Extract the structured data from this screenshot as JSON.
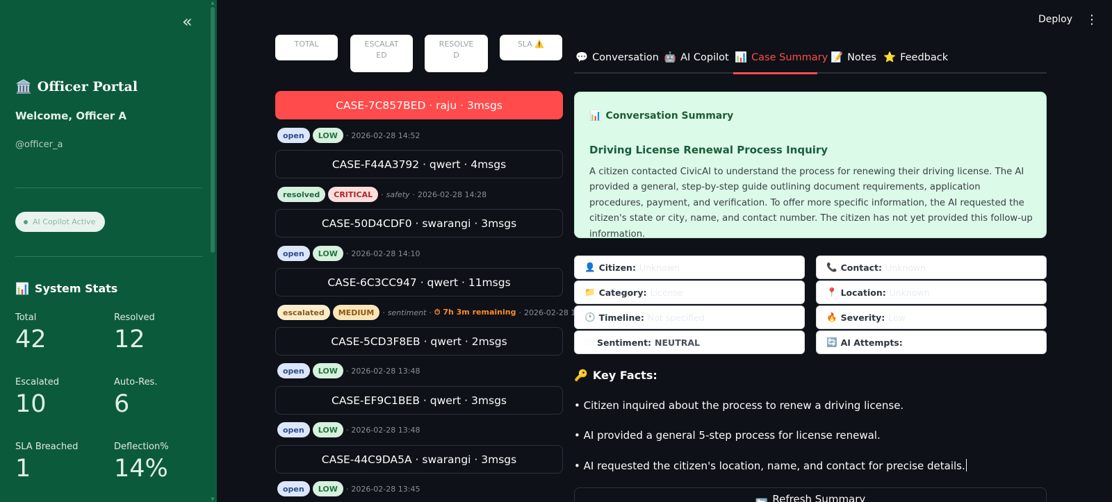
{
  "sidebar": {
    "collapse_icon": "«",
    "portal_icon": "🏛️",
    "portal_title": "Officer Portal",
    "welcome": "Welcome, Officer A",
    "handle": "@officer_a",
    "copilot_status": "AI Copilot Active",
    "stats_icon": "📊",
    "stats_title": "System Stats",
    "stats": [
      {
        "label": "Total",
        "value": "42"
      },
      {
        "label": "Resolved",
        "value": "12"
      },
      {
        "label": "Escalated",
        "value": "10"
      },
      {
        "label": "Auto-Res.",
        "value": "6"
      },
      {
        "label": "SLA Breached",
        "value": "1"
      },
      {
        "label": "Deflection%",
        "value": "14%"
      }
    ]
  },
  "topbar": {
    "deploy": "Deploy",
    "menu_icon": "⋮"
  },
  "metrics": {
    "total": "TOTAL",
    "escalated_1": "ESCALAT",
    "escalated_2": "ED",
    "resolved_1": "RESOLVE",
    "resolved_2": "D",
    "sla": "SLA ⚠️"
  },
  "cases": [
    {
      "label": "CASE-7C857BED · raju · 3msgs",
      "status": "open",
      "severity": "LOW",
      "topic": "",
      "sla": "",
      "time": "2026-02-28 14:52"
    },
    {
      "label": "CASE-F44A3792 · qwert · 4msgs",
      "status": "resolved",
      "severity": "CRITICAL",
      "topic": "safety",
      "sla": "",
      "time": "2026-02-28 14:28"
    },
    {
      "label": "CASE-50D4CDF0 · swarangi · 3msgs",
      "status": "open",
      "severity": "LOW",
      "topic": "",
      "sla": "",
      "time": "2026-02-28 14:10"
    },
    {
      "label": "CASE-6C3CC947 · qwert · 11msgs",
      "status": "escalated",
      "severity": "MEDIUM",
      "topic": "sentiment",
      "sla": "⏱ 7h 3m remaining",
      "time": "2026-02-28 13:56"
    },
    {
      "label": "CASE-5CD3F8EB · qwert · 2msgs",
      "status": "open",
      "severity": "LOW",
      "topic": "",
      "sla": "",
      "time": "2026-02-28 13:48"
    },
    {
      "label": "CASE-EF9C1BEB · qwert · 3msgs",
      "status": "open",
      "severity": "LOW",
      "topic": "",
      "sla": "",
      "time": "2026-02-28 13:48"
    },
    {
      "label": "CASE-44C9DA5A · swarangi · 3msgs",
      "status": "open",
      "severity": "LOW",
      "topic": "",
      "sla": "",
      "time": "2026-02-28 13:45"
    }
  ],
  "tabs": [
    {
      "icon": "💬",
      "label": "Conversation"
    },
    {
      "icon": "🤖",
      "label": "AI Copilot"
    },
    {
      "icon": "📊",
      "label": "Case Summary"
    },
    {
      "icon": "📝",
      "label": "Notes"
    },
    {
      "icon": "⭐",
      "label": "Feedback"
    }
  ],
  "summary": {
    "icon": "📊",
    "heading": "Conversation Summary",
    "title": "Driving License Renewal Process Inquiry",
    "body": "A citizen contacted CivicAI to understand the process for renewing their driving license. The AI provided a general, step-by-step guide outlining document requirements, application procedures, payment, and verification. To offer more specific information, the AI requested the citizen's state or city, name, and contact number. The citizen has not yet provided this follow-up information."
  },
  "fields": [
    {
      "icon": "👤",
      "key": "Citizen:",
      "value": "Unknown"
    },
    {
      "icon": "📞",
      "key": "Contact:",
      "value": "Unknown"
    },
    {
      "icon": "📁",
      "key": "Category:",
      "value": "License"
    },
    {
      "icon": "📍",
      "key": "Location:",
      "value": "Unknown"
    },
    {
      "icon": "🕐",
      "key": "Timeline:",
      "value": "Not specified"
    },
    {
      "icon": "🔥",
      "key": "Severity:",
      "value": "Low"
    },
    {
      "icon": "😐",
      "key": "Sentiment:",
      "value": "NEUTRAL"
    },
    {
      "icon": "🔄",
      "key": "AI Attempts:",
      "value": ""
    }
  ],
  "key_facts": {
    "icon": "🔑",
    "title": "Key Facts:",
    "items": [
      "• Citizen inquired about the process to renew a driving license.",
      "• AI provided a general 5-step process for license renewal.",
      "• AI requested the citizen's location, name, and contact for precise details."
    ]
  },
  "refresh": {
    "icon": "🔄",
    "label": "Refresh Summary"
  }
}
